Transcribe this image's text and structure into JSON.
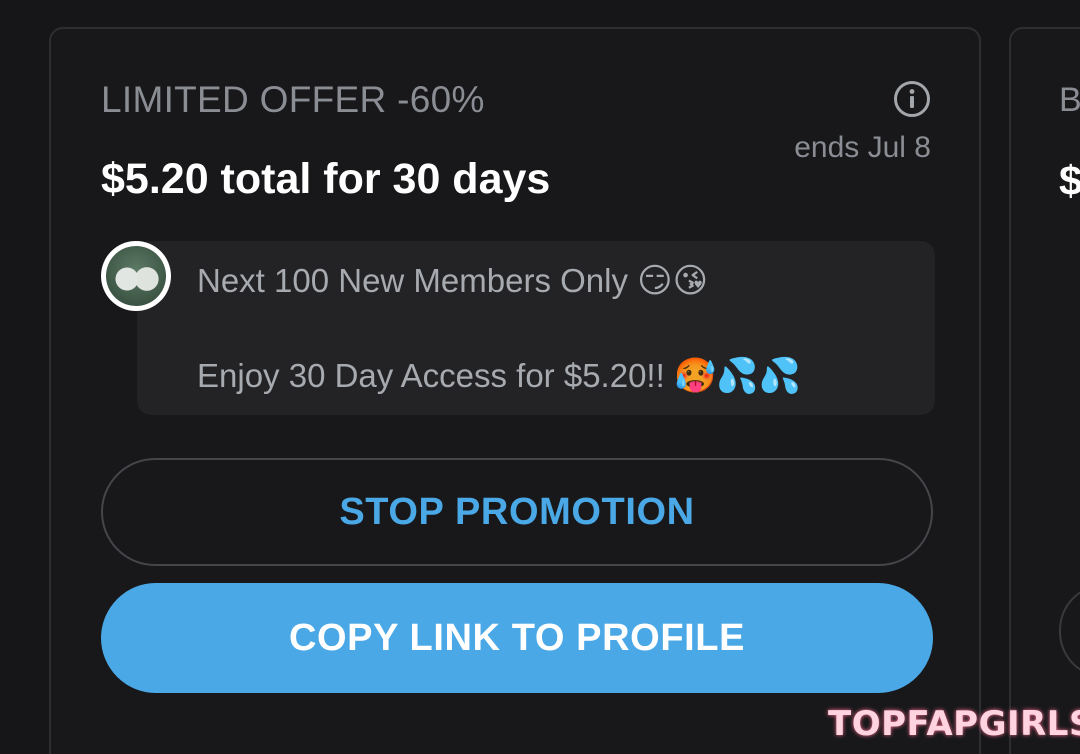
{
  "offer": {
    "title": "LIMITED OFFER -60%",
    "ends": "ends Jul 8",
    "price_line": "$5.20 total for 30 days",
    "info_icon": "info-circle-icon"
  },
  "message": {
    "line1_text": "Next 100 New Members Only",
    "line1_emoji": "😏😘",
    "line2_text": "Enjoy 30 Day Access for $5.20!!",
    "line2_emoji": "🥵💦💦"
  },
  "buttons": {
    "stop_label": "STOP PROMOTION",
    "copy_label": "COPY LINK TO PROFILE"
  },
  "next_card": {
    "title_partial": "B",
    "price_partial": "$"
  },
  "watermark": "TOPFAPGIRLS",
  "colors": {
    "background": "#161618",
    "card": "#18181a",
    "accent": "#4aa8e6",
    "muted_text": "#8a8d93"
  }
}
